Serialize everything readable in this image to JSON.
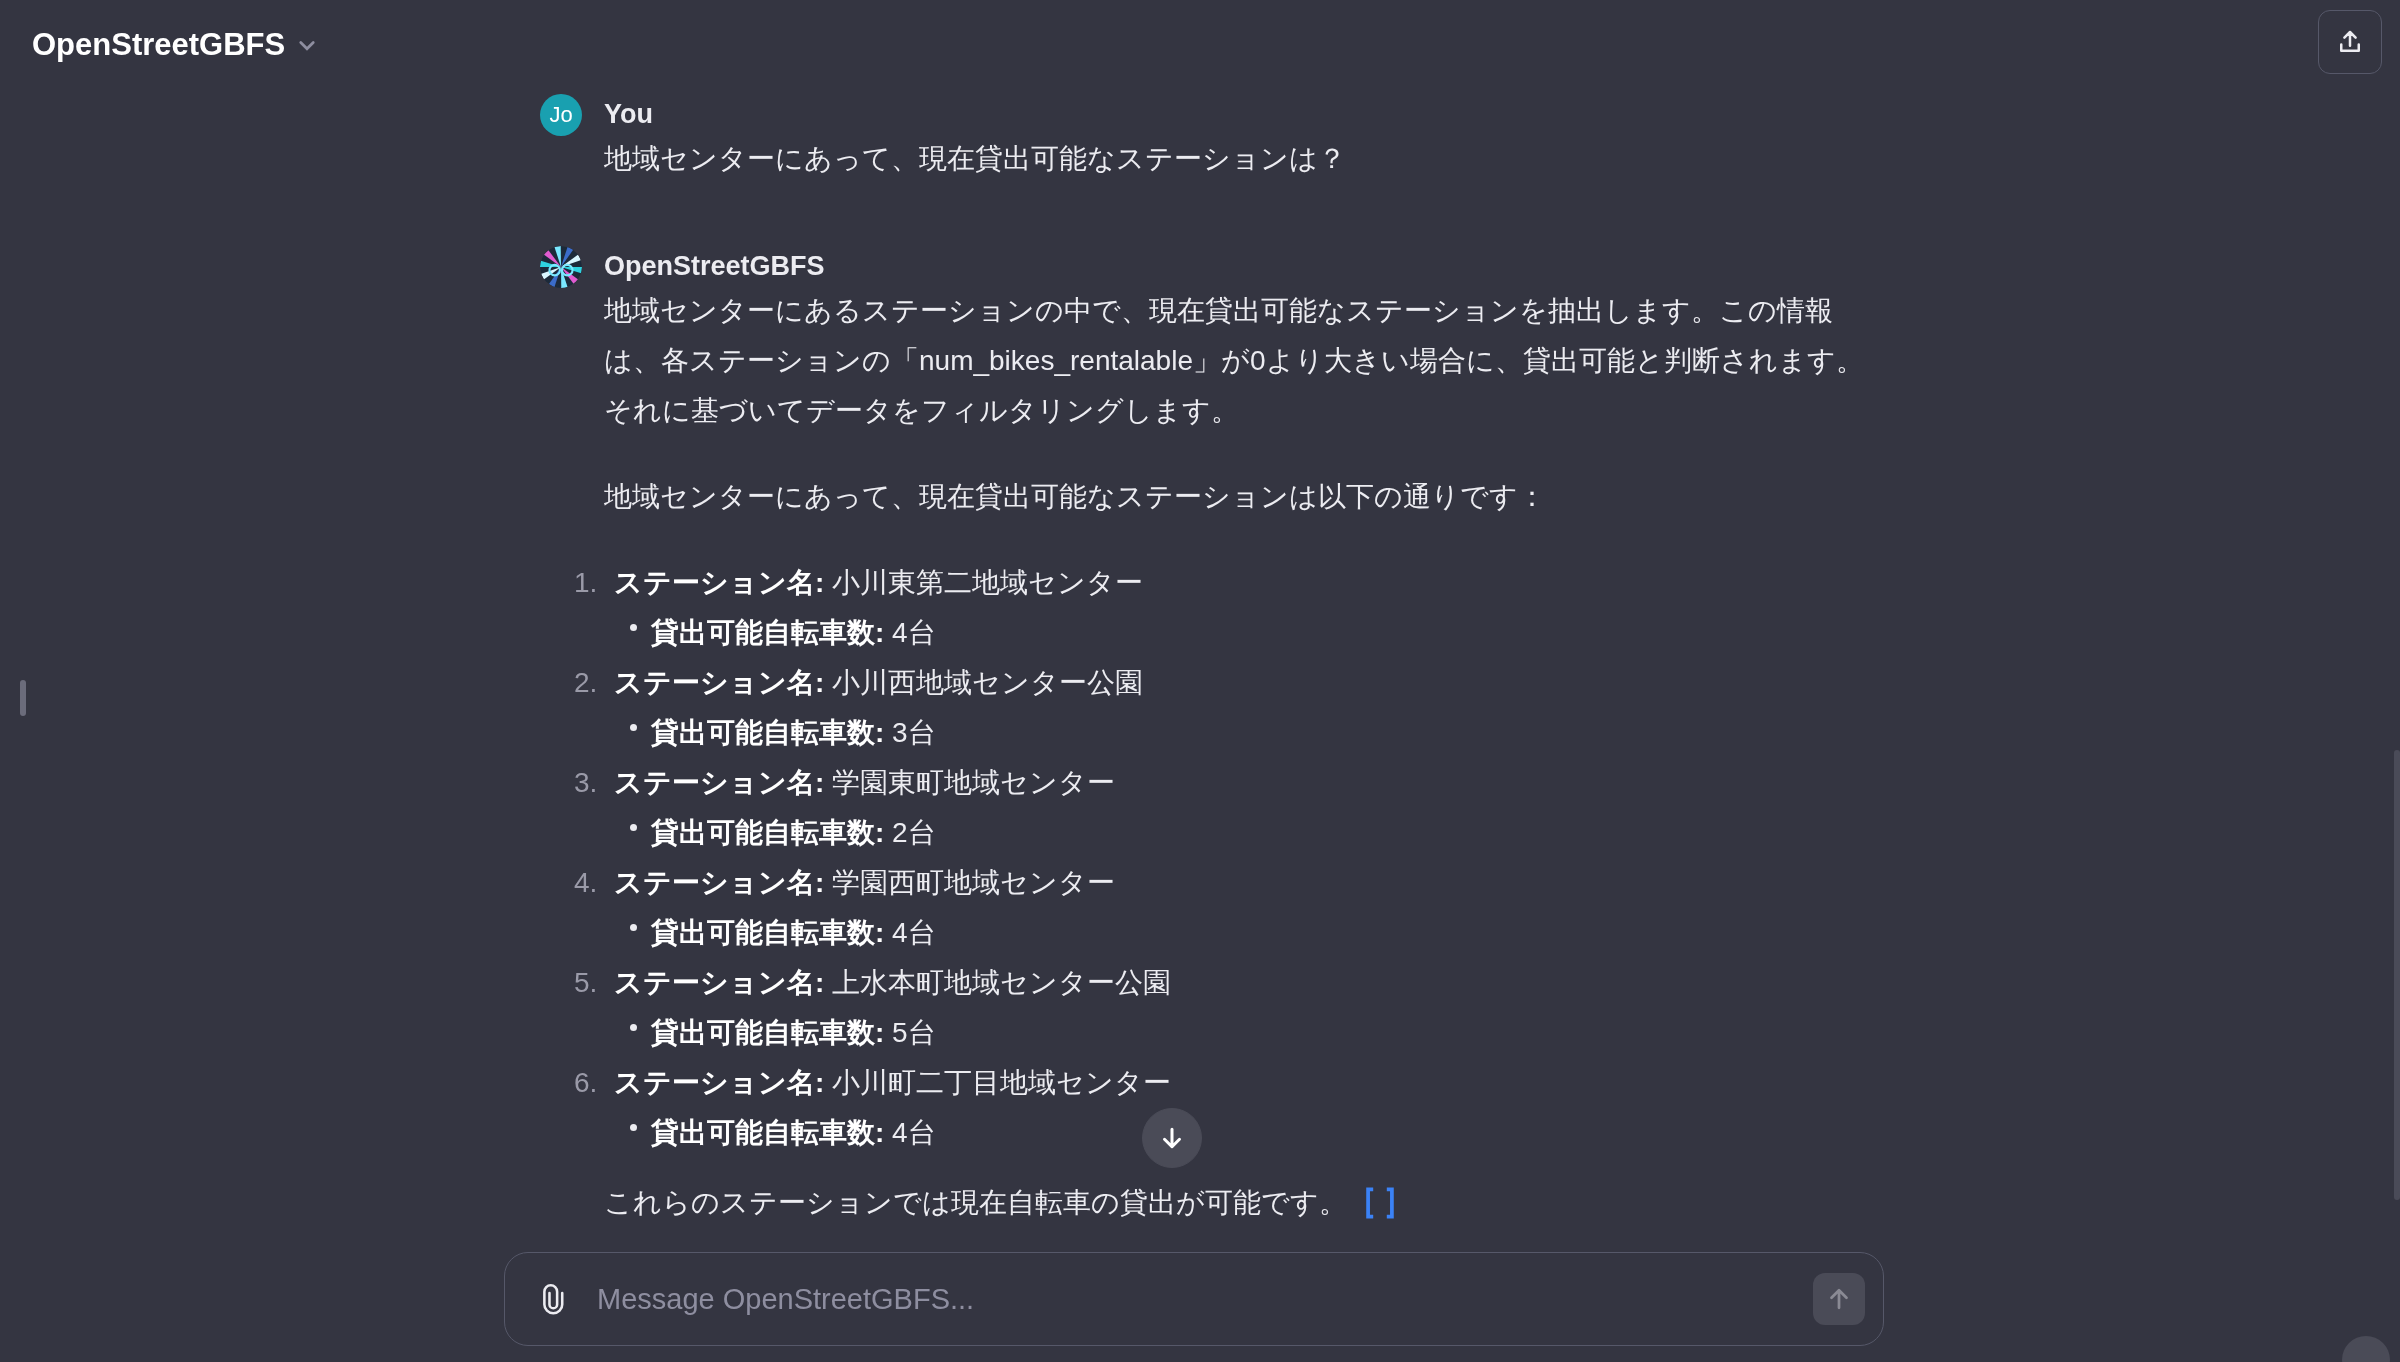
{
  "header": {
    "title": "OpenStreetGBFS"
  },
  "messages": [
    {
      "author": "You",
      "avatar": {
        "kind": "initials",
        "text": "Jo"
      },
      "paragraphs": [
        "地域センターにあって、現在貸出可能なステーションは？"
      ]
    },
    {
      "author": "OpenStreetGBFS",
      "paragraphs": [
        "地域センターにあるステーションの中で、現在貸出可能なステーションを抽出します。この情報は、各ステーションの「num_bikes_rentalable」が0より大きい場合に、貸出可能と判断されます。それに基づいてデータをフィルタリングします。",
        "地域センターにあって、現在貸出可能なステーションは以下の通りです："
      ],
      "stations": [
        {
          "number": "1.",
          "label": "ステーション名:",
          "name": "小川東第二地域センター",
          "detail_label": "貸出可能自転車数:",
          "count": "4台"
        },
        {
          "number": "2.",
          "label": "ステーション名:",
          "name": "小川西地域センター公園",
          "detail_label": "貸出可能自転車数:",
          "count": "3台"
        },
        {
          "number": "3.",
          "label": "ステーション名:",
          "name": "学園東町地域センター",
          "detail_label": "貸出可能自転車数:",
          "count": "2台"
        },
        {
          "number": "4.",
          "label": "ステーション名:",
          "name": "学園西町地域センター",
          "detail_label": "貸出可能自転車数:",
          "count": "4台"
        },
        {
          "number": "5.",
          "label": "ステーション名:",
          "name": "上水本町地域センター公園",
          "detail_label": "貸出可能自転車数:",
          "count": "5台"
        },
        {
          "number": "6.",
          "label": "ステーション名:",
          "name": "小川町二丁目地域センター",
          "detail_label": "貸出可能自転車数:",
          "count": "4台"
        }
      ],
      "closing": "これらのステーションでは現在自転車の貸出が可能です。"
    }
  ],
  "composer": {
    "placeholder": "Message OpenStreetGBFS..."
  }
}
